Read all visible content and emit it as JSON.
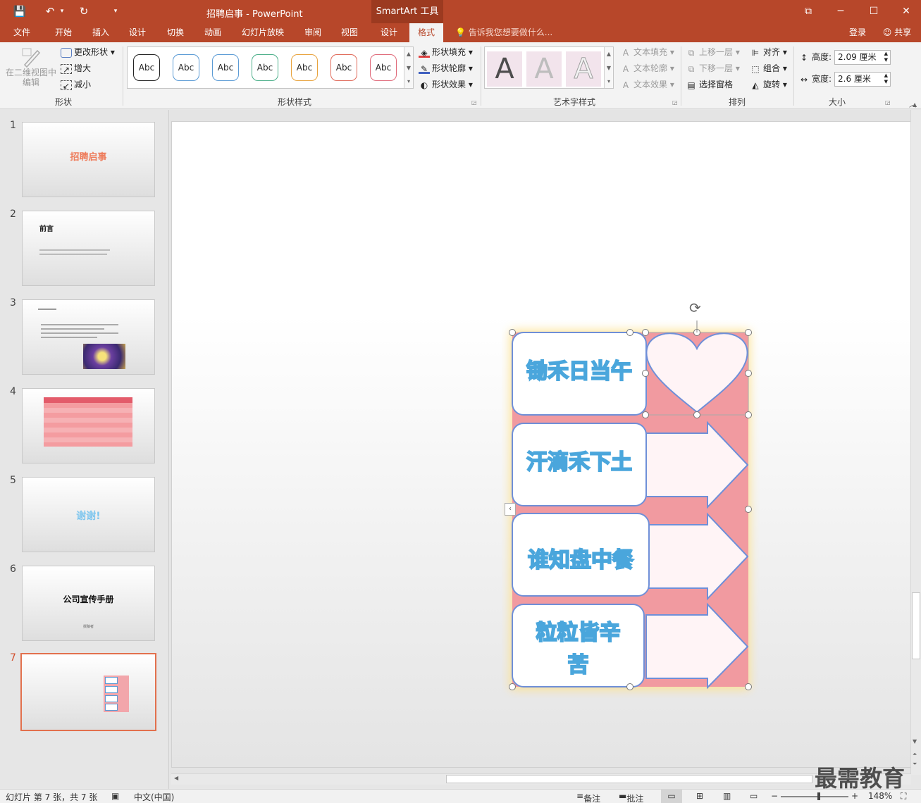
{
  "titlebar": {
    "title": "招聘启事 - PowerPoint",
    "context_tools": "SmartArt 工具",
    "qa_save": "💾",
    "qa_undo": "↶",
    "qa_undo_arrow": "▾",
    "qa_redo": "↻",
    "qa_custom": "▾",
    "win_restore": "⧉",
    "win_minimize": "─",
    "win_maximize": "☐",
    "win_close": "✕"
  },
  "tabs": {
    "items": [
      "文件",
      "开始",
      "插入",
      "设计",
      "切换",
      "动画",
      "幻灯片放映",
      "审阅",
      "视图",
      "设计",
      "格式"
    ],
    "tell_me": "告诉我您想要做什么...",
    "tell_me_icon": "💡",
    "login": "登录",
    "share": "共享"
  },
  "ribbon": {
    "shapes": {
      "edit_in_2d": "在二维视图中编辑",
      "change_shape": "更改形状",
      "larger": "增大",
      "smaller": "减小",
      "group_label": "形状"
    },
    "shape_styles": {
      "samples": [
        "Abc",
        "Abc",
        "Abc",
        "Abc",
        "Abc",
        "Abc",
        "Abc"
      ],
      "sample_colors": [
        "#222222",
        "#5b9bd5",
        "#5b9bd5",
        "#4caf8a",
        "#e8a33d",
        "#e06a5a",
        "#e06a7a"
      ],
      "fill": "形状填充",
      "outline": "形状轮廓",
      "effects": "形状效果",
      "group_label": "形状样式"
    },
    "wordart": {
      "letters": [
        "A",
        "A",
        "A"
      ],
      "text_fill": "文本填充",
      "text_outline": "文本轮廓",
      "text_effects": "文本效果",
      "group_label": "艺术字样式"
    },
    "arrange": {
      "bring_forward": "上移一层",
      "send_backward": "下移一层",
      "selection_pane": "选择窗格",
      "align": "对齐",
      "group": "组合",
      "rotate": "旋转",
      "group_label": "排列"
    },
    "size": {
      "height_label": "高度:",
      "height_value": "2.09 厘米",
      "width_label": "宽度:",
      "width_value": "2.6 厘米",
      "group_label": "大小"
    }
  },
  "slides": [
    {
      "num": "1",
      "title": "招聘启事"
    },
    {
      "num": "2",
      "title": "前言"
    },
    {
      "num": "3",
      "title": ""
    },
    {
      "num": "4",
      "title": ""
    },
    {
      "num": "5",
      "title": "谢谢!"
    },
    {
      "num": "6",
      "title": "公司宣传手册",
      "subtitle": "撰稿者"
    },
    {
      "num": "7",
      "title": ""
    }
  ],
  "smartart": {
    "lines": [
      "锄禾日当午",
      "汗滴禾下土",
      "谁知盘中餐",
      "粒粒皆辛",
      "苦"
    ],
    "colors": {
      "background": "#f19aa0",
      "box_border": "#6f8fd8",
      "text_fill": "#e9f5fc",
      "text_stroke": "#4aa6dc",
      "glow": "#fce7a0"
    }
  },
  "status": {
    "slide_info": "幻灯片 第 7 张，共 7 张",
    "language": "中文(中国)",
    "notes": "备注",
    "comments": "批注",
    "zoom": "148%"
  },
  "watermark": "最需教育"
}
